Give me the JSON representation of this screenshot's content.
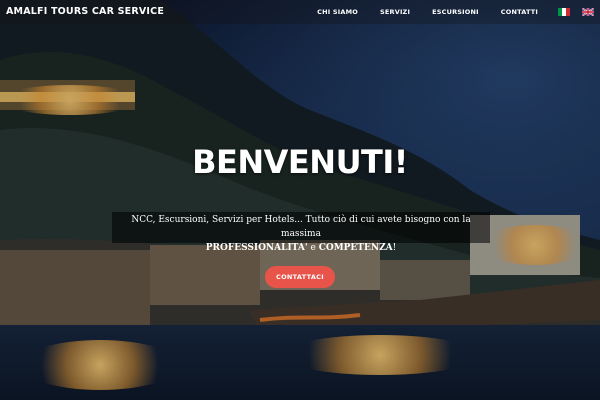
{
  "nav": {
    "brand": "AMALFI TOURS CAR SERVICE",
    "items": [
      {
        "label": "CHI SIAMO"
      },
      {
        "label": "SERVIZI"
      },
      {
        "label": "ESCURSIONI"
      },
      {
        "label": "CONTATTI"
      }
    ],
    "languages": [
      {
        "icon": "italian-flag-icon"
      },
      {
        "icon": "uk-flag-icon"
      }
    ]
  },
  "hero": {
    "title": "BENVENUTI!",
    "text_line1": "NCC, Escursioni, Servizi per Hotels... Tutto ciò di cui avete bisogno con la massima",
    "text_strong1": "PROFESSIONALITA'",
    "text_conj": " e ",
    "text_strong2": "COMPETENZA",
    "text_end": "!",
    "cta_label": "CONTATTACI"
  },
  "colors": {
    "cta": "#e8544a",
    "text": "#ffffff"
  }
}
